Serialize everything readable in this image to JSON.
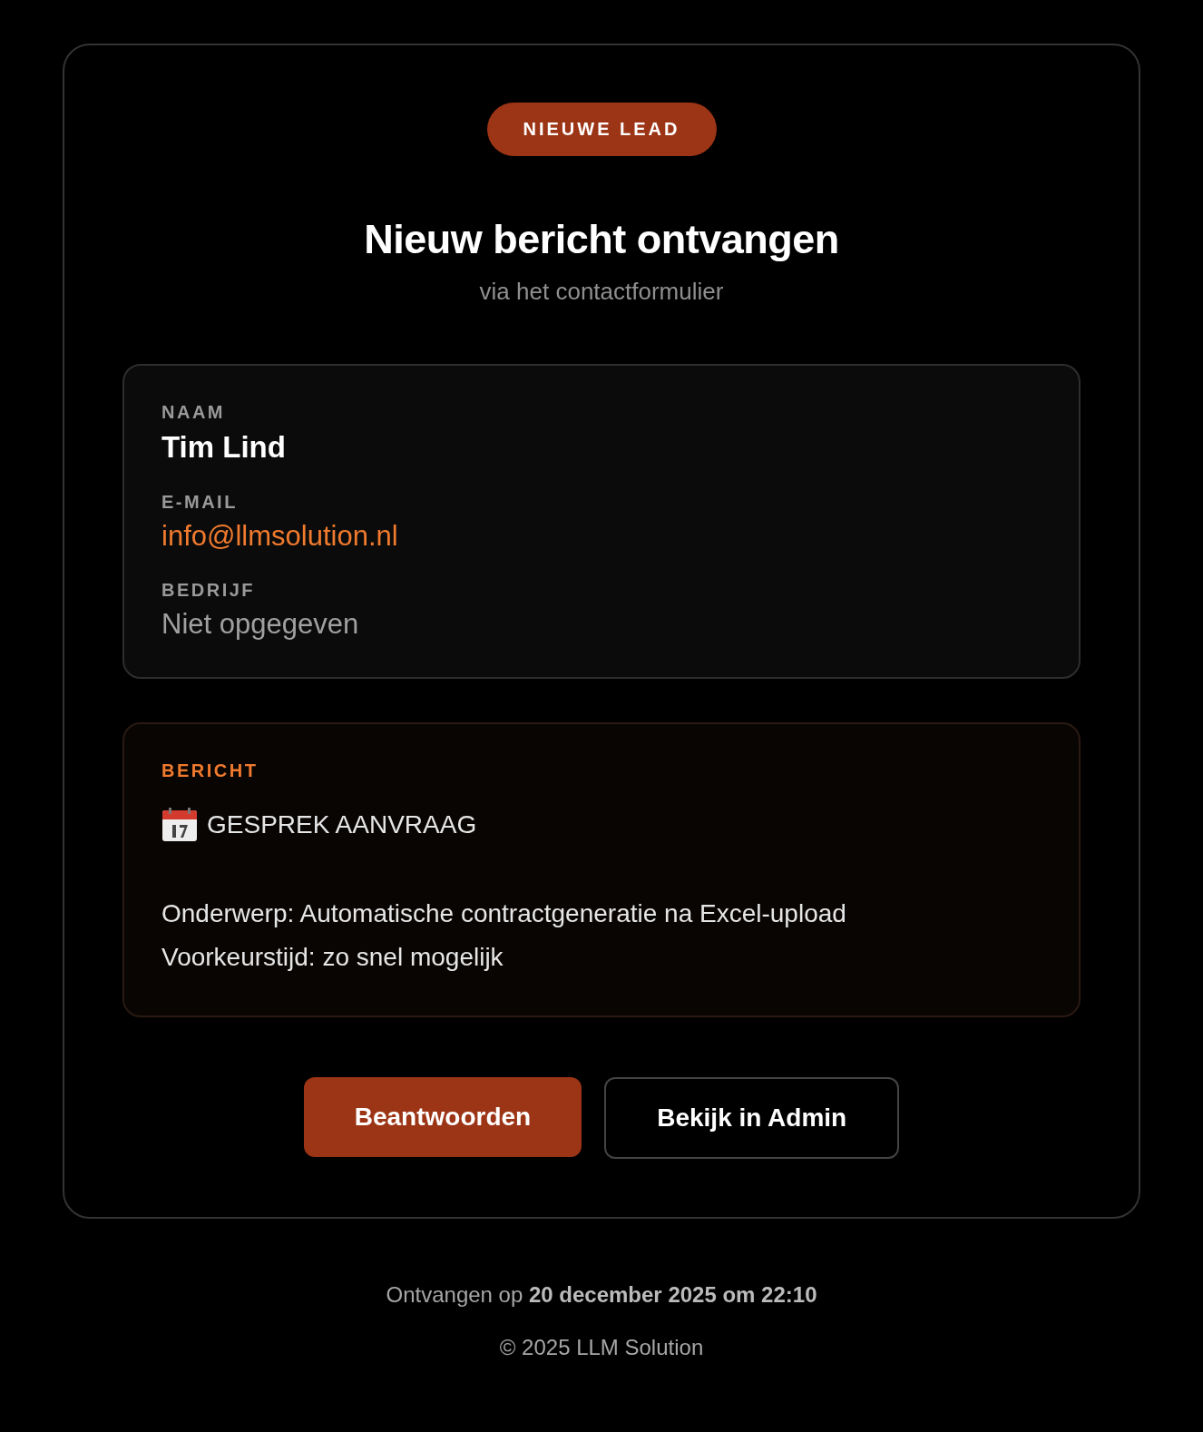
{
  "badge": "NIEUWE LEAD",
  "title": "Nieuw bericht ontvangen",
  "subtitle": "via het contactformulier",
  "fields": [
    {
      "label": "NAAM",
      "value": "Tim Lind",
      "kind": "name"
    },
    {
      "label": "E-MAIL",
      "value": "info@llmsolution.nl",
      "kind": "link"
    },
    {
      "label": "BEDRIJF",
      "value": "Niet opgegeven",
      "kind": "muted"
    }
  ],
  "message": {
    "label": "BERICHT",
    "heading": "GESPREK AANVRAAG",
    "lines": [
      "Onderwerp: Automatische contractgeneratie na Excel-upload",
      "Voorkeurstijd: zo snel mogelijk"
    ]
  },
  "buttons": [
    {
      "label": "Beantwoorden",
      "kind": "primary"
    },
    {
      "label": "Bekijk in Admin",
      "kind": "outline"
    }
  ],
  "footer": {
    "received": "Ontvangen op **20 december 2025 om 22:10**",
    "copyright": "© 2025 LLM Solution"
  }
}
